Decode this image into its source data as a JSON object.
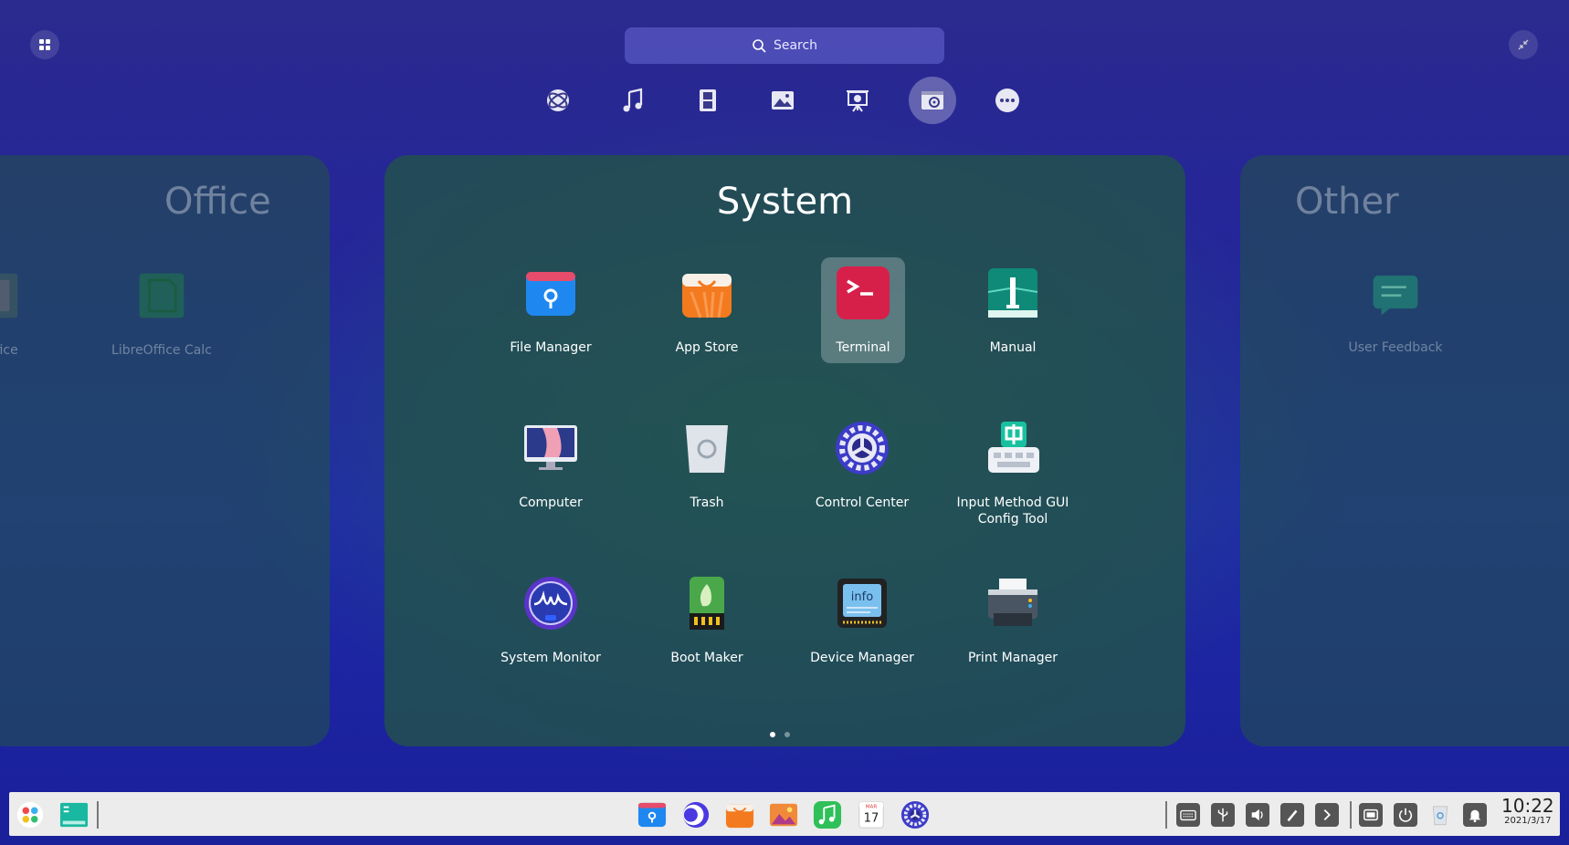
{
  "search": {
    "placeholder": "Search"
  },
  "categories": [
    {
      "icon": "internet-icon"
    },
    {
      "icon": "music-icon"
    },
    {
      "icon": "video-icon"
    },
    {
      "icon": "image-icon"
    },
    {
      "icon": "presentation-icon"
    },
    {
      "icon": "system-icon",
      "active": true
    },
    {
      "icon": "more-icon"
    }
  ],
  "panels": {
    "left": {
      "title": "Office",
      "apps": [
        "eOffice",
        "LibreOffice Calc"
      ]
    },
    "center": {
      "title": "System",
      "apps": [
        "File Manager",
        "App Store",
        "Terminal",
        "Manual",
        "Computer",
        "Trash",
        "Control Center",
        "Input Method GUI Config Tool",
        "System Monitor",
        "Boot Maker",
        "Device Manager",
        "Print Manager"
      ],
      "selected": "Terminal"
    },
    "right": {
      "title": "Other",
      "apps": [
        "User Feedback"
      ]
    }
  },
  "taskbar": {
    "time": "10:22",
    "date": "2021/3/17",
    "calendar_month": "MAR",
    "calendar_day": "17"
  },
  "colors": {
    "accent": "#2b2a8e",
    "panel": "#23554a",
    "terminal": "#d6204a"
  }
}
